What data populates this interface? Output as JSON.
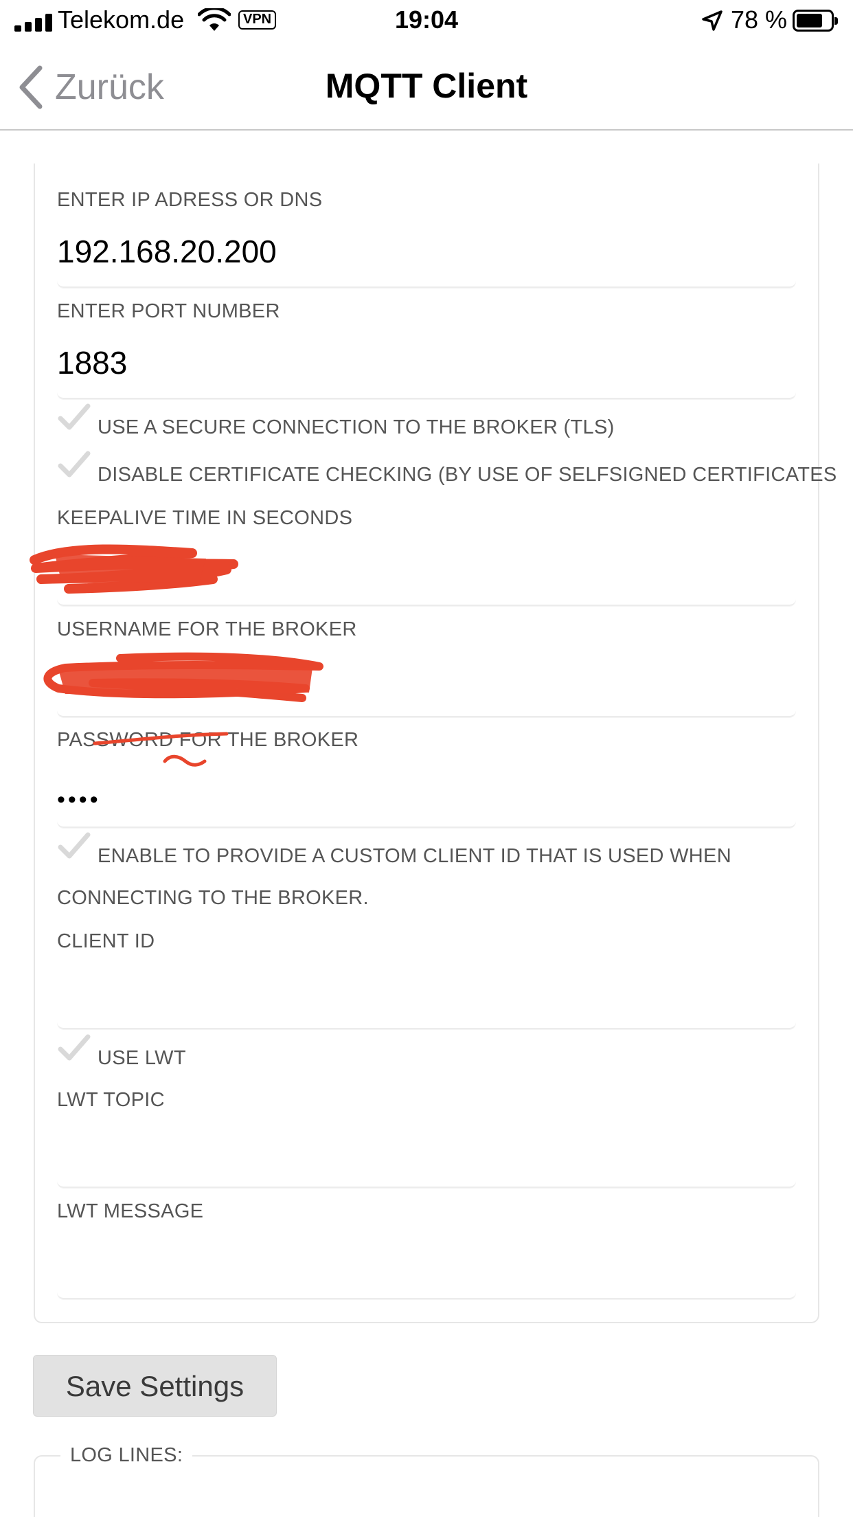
{
  "status_bar": {
    "carrier": "Telekom.de",
    "vpn_badge": "VPN",
    "time": "19:04",
    "battery_percent": "78 %",
    "battery_level": 0.78,
    "icons": [
      "signal-icon",
      "wifi-icon",
      "location-arrow-icon",
      "battery-icon"
    ]
  },
  "nav": {
    "back_label": "Zurück",
    "title": "MQTT Client"
  },
  "form": {
    "host": {
      "label": "ENTER IP ADRESS OR DNS",
      "value": "192.168.20.200"
    },
    "port": {
      "label": "ENTER PORT NUMBER",
      "value": "1883"
    },
    "use_tls": {
      "label": "USE A SECURE CONNECTION TO THE BROKER (TLS)",
      "checked": true
    },
    "disable_cert_check": {
      "label": "DISABLE CERTIFICATE CHECKING (BY USE OF SELFSIGNED CERTIFICATES",
      "checked": true
    },
    "keepalive": {
      "label": "KEEPALIVE TIME IN SECONDS",
      "value": ""
    },
    "username": {
      "label": "USERNAME FOR THE BROKER",
      "value": ""
    },
    "password": {
      "label": "PASSWORD FOR THE BROKER",
      "value": "••••"
    },
    "custom_client_id": {
      "label_line1": "ENABLE TO PROVIDE A CUSTOM CLIENT ID THAT IS USED WHEN",
      "label_line2": "CONNECTING TO THE BROKER.",
      "checked": true
    },
    "client_id": {
      "label": "CLIENT ID",
      "value": ""
    },
    "use_lwt": {
      "label": "USE LWT",
      "checked": true
    },
    "lwt_topic": {
      "label": "LWT TOPIC",
      "value": ""
    },
    "lwt_message": {
      "label": "LWT MESSAGE",
      "value": ""
    }
  },
  "save_button_label": "Save Settings",
  "log": {
    "legend": "LOG LINES:"
  },
  "colors": {
    "label": "#555555",
    "checkmark": "#d9d9d9",
    "redaction": "#e8452c",
    "button_bg": "#e2e2e2"
  }
}
